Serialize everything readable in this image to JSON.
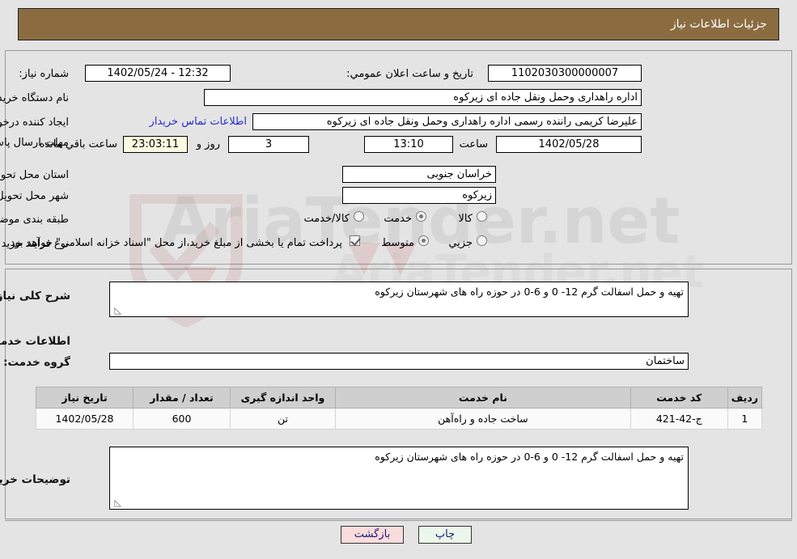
{
  "header": {
    "title": "جزئیات اطلاعات نیاز"
  },
  "fields": {
    "need_number_label": "شماره نیاز:",
    "need_number_value": "1102030300000007",
    "announce_label": "تاریخ و ساعت اعلان عمومي:",
    "announce_value": "12:32 - 1402/05/24",
    "buyer_org_label": "نام دستگاه خریدار:",
    "buyer_org_value": "اداره راهداری وحمل ونقل جاده ای زیرکوه",
    "creator_label": "ایجاد کننده درخواست:",
    "creator_value": "علیرضا کریمی راننده رسمی اداره راهداری وحمل ونقل جاده ای زیرکوه",
    "contact_link": "اطلاعات تماس خریدار",
    "deadline_label": "مهلت ارسال پاسخ: تا تاریخ:",
    "deadline_date": "1402/05/28",
    "deadline_hour_label": "ساعت",
    "deadline_hour_value": "13:10",
    "days_value": "3",
    "days_label": "روز و",
    "countdown_value": "23:03:11",
    "countdown_label": "ساعت باقي مانده",
    "province_label": "استان محل تحویل:",
    "province_value": "خراسان جنوبی",
    "city_label": "شهر محل تحویل:",
    "city_value": "زیرکوه",
    "category_label": "طبقه بندی موضوعی:",
    "purchase_type_label": "نوع فرآیند خرید :",
    "treasury_note": "پرداخت تمام یا بخشی از مبلغ خرید،از محل \"اسناد خزانه اسلامی\" خواهد بود."
  },
  "category_options": [
    {
      "label": "کالا",
      "selected": false
    },
    {
      "label": "خدمت",
      "selected": true
    },
    {
      "label": "کالا/خدمت",
      "selected": false
    }
  ],
  "purchase_options": [
    {
      "label": "جزیي",
      "selected": false
    },
    {
      "label": "متوسط",
      "selected": true
    }
  ],
  "treasury_checkbox": {
    "checked": true
  },
  "middle": {
    "overview_label": "شرح کلی نیاز:",
    "overview_value": "تهیه و حمل اسفالت گرم 12-  0  و        6-0            در حوزه راه های شهرستان زیرکوه",
    "services_heading": "اطلاعات خدمات مورد نیاز",
    "service_group_label": "گروه خدمت:",
    "service_group_value": "ساختمان",
    "buyer_notes_label": "توضیحات خریدار:",
    "buyer_notes_value": "تهیه و حمل اسفالت گرم 12-  0  و        6-0            در حوزه راه های شهرستان زیرکوه"
  },
  "table": {
    "headers": [
      "ردیف",
      "کد خدمت",
      "نام خدمت",
      "واحد اندازه گیری",
      "تعداد / مقدار",
      "تاریخ نیاز"
    ],
    "rows": [
      {
        "row": "1",
        "code": "ج-42-421",
        "name": "ساخت جاده و راه‌آهن",
        "unit": "تن",
        "qty": "600",
        "date": "1402/05/28"
      }
    ]
  },
  "footer": {
    "print_label": "چاپ",
    "back_label": "بازگشت"
  },
  "watermark": {
    "text": "AriaTender.net"
  },
  "colors": {
    "header_bg": "#8b6c41",
    "page_bg": "#e4e4e4",
    "link": "#2a2ad0",
    "print_btn_bg": "#eaf7ea",
    "back_btn_bg": "#fadcdc",
    "countdown_bg": "#fbfbe2",
    "table_header_bg": "#cfcfcf"
  }
}
